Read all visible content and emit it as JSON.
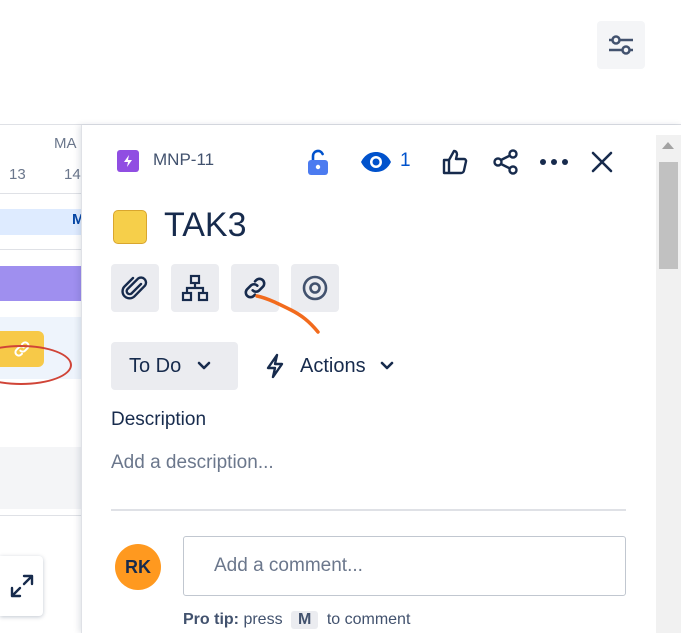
{
  "timeline": {
    "month_label": "MA",
    "days": [
      "13",
      "14"
    ],
    "band_letter": "M"
  },
  "issue": {
    "type_icon": "lightning-icon",
    "key": "MNP-11",
    "title": "TAK3",
    "color": "#f6cf4a",
    "watch_count": "1"
  },
  "header_actions": [
    "unlock-icon",
    "eye-icon",
    "thumbs-up-icon",
    "share-icon",
    "more-icon",
    "close-icon"
  ],
  "toolbar": [
    "attachment-icon",
    "child-issues-icon",
    "link-icon",
    "target-icon"
  ],
  "status": {
    "label": "To Do"
  },
  "actions": {
    "label": "Actions"
  },
  "description": {
    "label": "Description",
    "placeholder": "Add a description..."
  },
  "comment": {
    "avatar_initials": "RK",
    "placeholder": "Add a comment...",
    "protip_label": "Pro tip:",
    "protip_press": "press",
    "protip_key": "M",
    "protip_rest": "to comment"
  },
  "colors": {
    "accent": "#0052cc",
    "issue_type": "#904ee2",
    "avatar": "#ff991f"
  }
}
